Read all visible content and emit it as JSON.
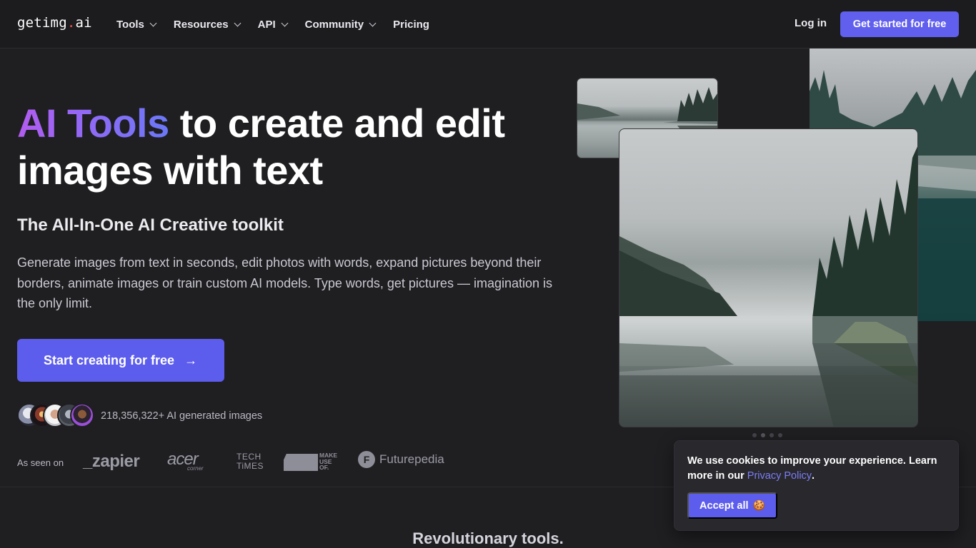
{
  "nav": {
    "logo_main": "getimg",
    "logo_dot": ".",
    "logo_suffix": "ai",
    "items": [
      {
        "label": "Tools",
        "has_dropdown": true
      },
      {
        "label": "Resources",
        "has_dropdown": true
      },
      {
        "label": "API",
        "has_dropdown": true
      },
      {
        "label": "Community",
        "has_dropdown": true
      },
      {
        "label": "Pricing",
        "has_dropdown": false
      }
    ],
    "login": "Log in",
    "cta": "Get started for free"
  },
  "hero": {
    "title_highlight": "AI Tools",
    "title_rest": " to create and edit images with text",
    "subtitle": "The All-In-One AI Creative toolkit",
    "description": "Generate images from text in seconds, edit photos with words, expand pictures beyond their borders, animate images or train custom AI models. Type words, get pictures — imagination is the only limit.",
    "cta": "Start creating for free",
    "cta_icon": "arrow-right-icon",
    "generated_count": "218,356,322+ AI generated images"
  },
  "seen_on": {
    "label": "As seen on",
    "brands": {
      "zapier": "_zapier",
      "acer": "acer",
      "acer_sub": "corner",
      "techtimes_line1": "TECH",
      "techtimes_line2": "TiMES",
      "muo_line1": "MAKE",
      "muo_line2": "USE",
      "muo_line3": "OF.",
      "futurepedia_mark": "F",
      "futurepedia": "Futurepedia"
    }
  },
  "carousel": {
    "dot_count": 4,
    "active_index": 1
  },
  "section": {
    "title": "Revolutionary tools."
  },
  "cookie": {
    "text": "We use cookies to improve your experience. Learn more in our ",
    "link": "Privacy Policy",
    "end": ".",
    "accept": "Accept all",
    "accept_icon": "🍪"
  },
  "colors": {
    "background": "#1f1f22",
    "accent": "#5d5ded",
    "gradient_start": "#b25cf0",
    "gradient_end": "#6a78f8"
  }
}
